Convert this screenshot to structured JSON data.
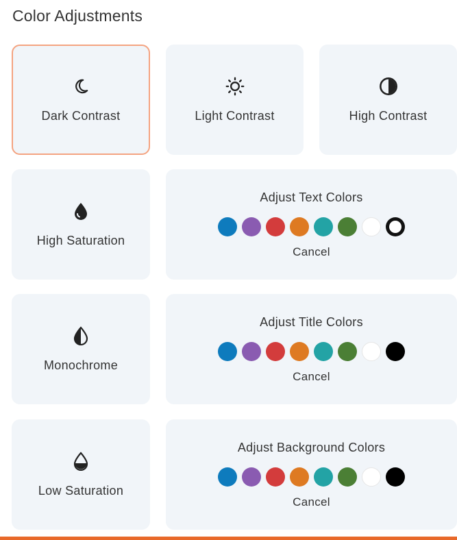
{
  "panel": {
    "title": "Color Adjustments"
  },
  "cards": [
    {
      "label": "Dark Contrast",
      "icon": "moon-icon",
      "selected": true
    },
    {
      "label": "Light Contrast",
      "icon": "sun-icon"
    },
    {
      "label": "High Contrast",
      "icon": "contrast-icon"
    },
    {
      "label": "High Saturation",
      "icon": "drop-filled-icon"
    },
    {
      "label": "Monochrome",
      "icon": "drop-half-icon"
    },
    {
      "label": "Low Saturation",
      "icon": "drop-low-icon"
    }
  ],
  "color_sections": [
    {
      "title": "Adjust Text Colors",
      "cancel": "Cancel",
      "active_swatch": 7
    },
    {
      "title": "Adjust Title Colors",
      "cancel": "Cancel"
    },
    {
      "title": "Adjust Background Colors",
      "cancel": "Cancel"
    }
  ],
  "swatch_colors": [
    "#0e7bbd",
    "#8a5bb1",
    "#d33c3c",
    "#de7a22",
    "#23a3a5",
    "#4b7f35",
    "#ffffff",
    "#000000"
  ],
  "accent_color": "#e8692a",
  "selected_border_color": "#f4a380"
}
